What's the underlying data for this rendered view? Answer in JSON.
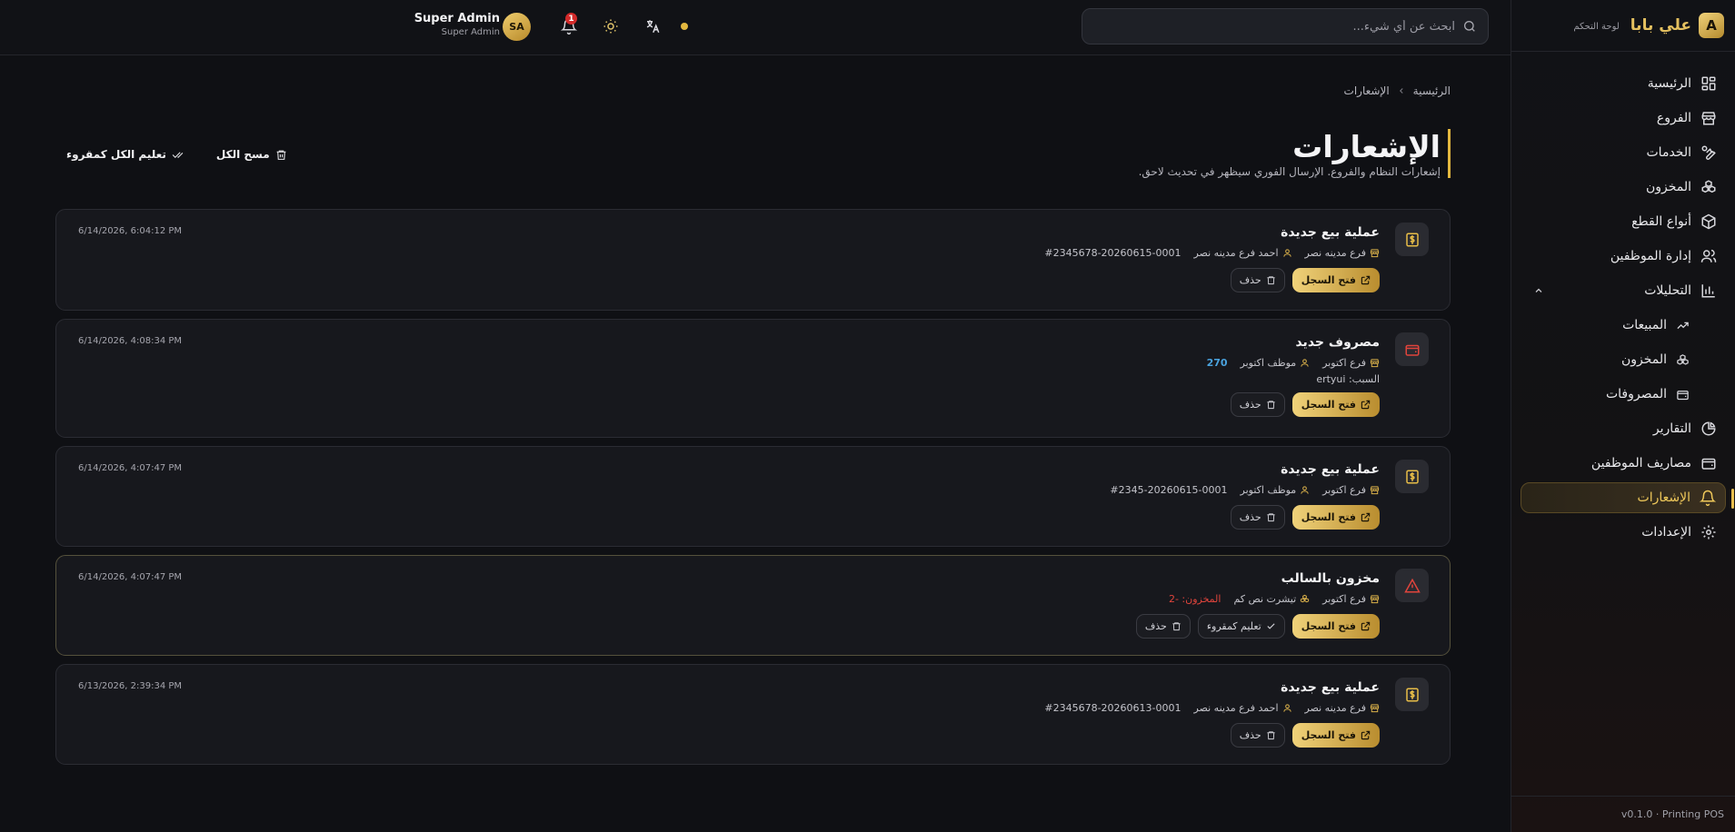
{
  "sidebar": {
    "logo_letter": "A",
    "brand": "علي بابا",
    "brand_sub": "لوحة التحكم",
    "items": [
      {
        "label": "الرئيسية",
        "icon": "dashboard-icon"
      },
      {
        "label": "الفروع",
        "icon": "store-icon"
      },
      {
        "label": "الخدمات",
        "icon": "wrench-icon"
      },
      {
        "label": "المخزون",
        "icon": "boxes-icon"
      },
      {
        "label": "أنواع القطع",
        "icon": "package-icon"
      },
      {
        "label": "إدارة الموظفين",
        "icon": "users-icon"
      },
      {
        "label": "التحليلات",
        "icon": "bar-chart-icon",
        "expanded": true
      },
      {
        "label": "المبيعات",
        "icon": "trending-up-icon",
        "sub": true
      },
      {
        "label": "المخزون",
        "icon": "boxes-icon",
        "sub": true
      },
      {
        "label": "المصروفات",
        "icon": "wallet-icon",
        "sub": true
      },
      {
        "label": "التقارير",
        "icon": "pie-chart-icon"
      },
      {
        "label": "مصاريف الموظفين",
        "icon": "wallet-icon"
      },
      {
        "label": "الإشعارات",
        "icon": "bell-icon",
        "active": true
      },
      {
        "label": "الإعدادات",
        "icon": "gear-icon"
      }
    ],
    "footer": "v0.1.0 · Printing POS"
  },
  "header": {
    "search_placeholder": "ابحث عن أي شيء...",
    "notification_count": "1",
    "user_initials": "SA",
    "user_name": "Super Admin",
    "user_role": "Super Admin"
  },
  "page": {
    "breadcrumb": [
      "الرئيسية",
      "الإشعارات"
    ],
    "title": "الإشعارات",
    "subtitle": "إشعارات النظام والفروع. الإرسال الفوري سيظهر في تحديث لاحق.",
    "mark_all_read": "تعليم الكل كمقروء",
    "clear_all": "مسح الكل"
  },
  "labels": {
    "open_record": "فتح السجل",
    "delete": "حذف",
    "mark_read": "تعليم كمقروء"
  },
  "notifications": [
    {
      "type": "sale",
      "title": "عملية بيع جديدة",
      "branch": "فرع مدينه نصر",
      "person": "احمد فرع مدينه نصر",
      "reference": "#2345678-20260615-0001",
      "time": "6/14/2026, 6:04:12 PM"
    },
    {
      "type": "expense",
      "title": "مصروف جديد",
      "branch": "فرع اكتوبر",
      "person": "موظف اكتوبر",
      "amount": "270",
      "reason": "السبب: ertyui",
      "time": "6/14/2026, 4:08:34 PM"
    },
    {
      "type": "sale",
      "title": "عملية بيع جديدة",
      "branch": "فرع اكتوبر",
      "person": "موظف اكتوبر",
      "reference": "#2345-20260615-0001",
      "time": "6/14/2026, 4:07:47 PM"
    },
    {
      "type": "stock",
      "title": "مخزون بالسالب",
      "branch": "فرع اكتوبر",
      "item": "تيشرت نص كم",
      "stock": "المخزون: -2",
      "time": "6/14/2026, 4:07:47 PM",
      "unread": true
    },
    {
      "type": "sale",
      "title": "عملية بيع جديدة",
      "branch": "فرع مدينه نصر",
      "person": "احمد فرع مدينه نصر",
      "reference": "#2345678-20260613-0001",
      "time": "6/13/2026, 2:39:34 PM"
    }
  ],
  "colors": {
    "accent": "#e3b83f",
    "background": "#0f1014",
    "card": "#17181d",
    "danger": "#e0443c",
    "amount": "#4aa3df"
  }
}
